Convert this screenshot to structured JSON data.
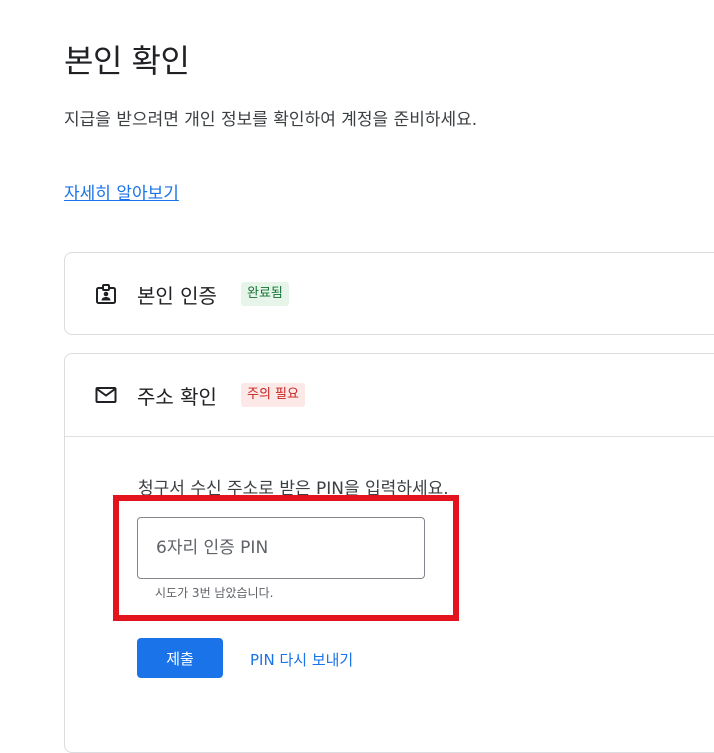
{
  "page": {
    "title": "본인 확인",
    "intro": "지급을 받으려면 개인 정보를 확인하여 계정을 준비하세요.",
    "learn_more": "자세히 알아보기"
  },
  "identity_card": {
    "icon": "id-badge-icon",
    "title": "본인 인증",
    "badge": "완료됨",
    "badge_color": "#137333"
  },
  "address_card": {
    "icon": "mail-icon",
    "title": "주소 확인",
    "badge": "주의 필요",
    "badge_color": "#c5221f",
    "instruction": "청구서 수신 주소로 받은 PIN을 입력하세요.",
    "pin_placeholder": "6자리 인증 PIN",
    "pin_value": "",
    "attempts_text": "시도가 3번 남았습니다.",
    "submit_label": "제출",
    "resend_label": "PIN 다시 보내기"
  },
  "colors": {
    "accent": "#1a73e8",
    "highlight": "#e3141d"
  }
}
